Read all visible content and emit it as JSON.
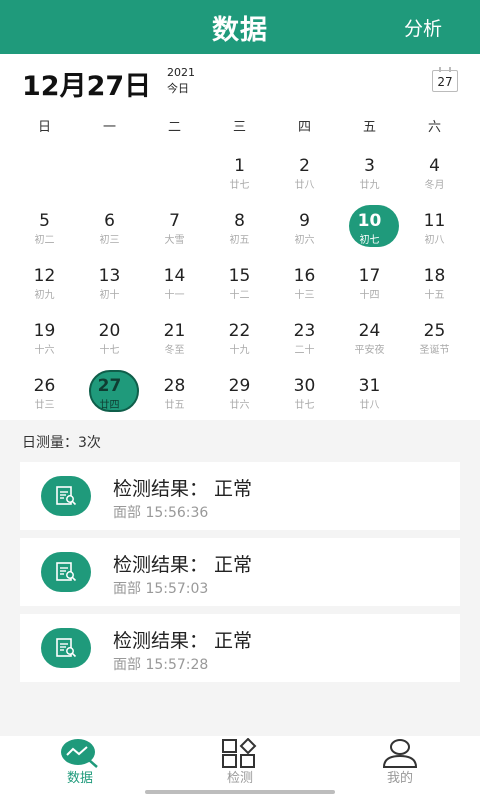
{
  "header": {
    "title": "数据",
    "analyze_label": "分析"
  },
  "date_row": {
    "big_date": "12月27日",
    "year": "2021",
    "today_label": "今日",
    "calendar_button_day": "27"
  },
  "weekdays": [
    "日",
    "一",
    "二",
    "三",
    "四",
    "五",
    "六"
  ],
  "calendar": {
    "days": [
      {
        "num": "1",
        "lunar": "廿七"
      },
      {
        "num": "2",
        "lunar": "廿八"
      },
      {
        "num": "3",
        "lunar": "廿九"
      },
      {
        "num": "4",
        "lunar": "冬月"
      },
      {
        "num": "5",
        "lunar": "初二"
      },
      {
        "num": "6",
        "lunar": "初三"
      },
      {
        "num": "7",
        "lunar": "大雪"
      },
      {
        "num": "8",
        "lunar": "初五"
      },
      {
        "num": "9",
        "lunar": "初六"
      },
      {
        "num": "10",
        "lunar": "初七"
      },
      {
        "num": "11",
        "lunar": "初八"
      },
      {
        "num": "12",
        "lunar": "初九"
      },
      {
        "num": "13",
        "lunar": "初十"
      },
      {
        "num": "14",
        "lunar": "十一"
      },
      {
        "num": "15",
        "lunar": "十二"
      },
      {
        "num": "16",
        "lunar": "十三"
      },
      {
        "num": "17",
        "lunar": "十四"
      },
      {
        "num": "18",
        "lunar": "十五"
      },
      {
        "num": "19",
        "lunar": "十六"
      },
      {
        "num": "20",
        "lunar": "十七"
      },
      {
        "num": "21",
        "lunar": "冬至"
      },
      {
        "num": "22",
        "lunar": "十九"
      },
      {
        "num": "23",
        "lunar": "二十"
      },
      {
        "num": "24",
        "lunar": "平安夜"
      },
      {
        "num": "25",
        "lunar": "圣诞节"
      },
      {
        "num": "26",
        "lunar": "廿三"
      },
      {
        "num": "27",
        "lunar": "廿四"
      },
      {
        "num": "28",
        "lunar": "廿五"
      },
      {
        "num": "29",
        "lunar": "廿六"
      },
      {
        "num": "30",
        "lunar": "廿七"
      },
      {
        "num": "31",
        "lunar": "廿八"
      }
    ],
    "selected_day": "10",
    "today_day": "27"
  },
  "summary": {
    "count_text": "日测量：3次"
  },
  "records": [
    {
      "result": "检测结果：  正常",
      "time": "面部 15:56:36"
    },
    {
      "result": "检测结果：  正常",
      "time": "面部 15:57:03"
    },
    {
      "result": "检测结果：  正常",
      "time": "面部 15:57:28"
    }
  ],
  "nav": {
    "items": [
      {
        "label": "数据",
        "icon": "chart-icon",
        "active": true
      },
      {
        "label": "检测",
        "icon": "grid-icon",
        "active": false
      },
      {
        "label": "我的",
        "icon": "user-icon",
        "active": false
      }
    ]
  },
  "colors": {
    "accent": "#1f9a7b",
    "accent_dark": "#0f5e4a"
  }
}
